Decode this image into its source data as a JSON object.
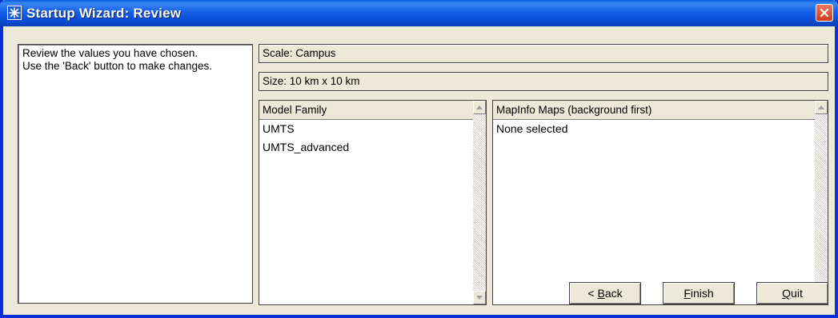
{
  "window": {
    "title": "Startup Wizard: Review"
  },
  "instructions": {
    "line1": "Review the values you have chosen.",
    "line2": "Use the 'Back' button to make changes."
  },
  "summary": {
    "scale": "Scale: Campus",
    "size": "Size: 10 km x 10 km"
  },
  "model_family": {
    "header": "Model Family",
    "items": [
      "UMTS",
      "UMTS_advanced"
    ]
  },
  "mapinfo": {
    "header": "MapInfo Maps (background first)",
    "items": [
      "None selected"
    ]
  },
  "buttons": {
    "back": {
      "prefix": "< ",
      "mnemonic": "B",
      "rest": "ack"
    },
    "finish": {
      "mnemonic": "F",
      "rest": "inish"
    },
    "quit": {
      "mnemonic": "Q",
      "rest": "uit"
    }
  },
  "icons": {
    "app": "star-icon",
    "close": "close-icon",
    "scroll_up": "arrow-up-icon",
    "scroll_down": "arrow-down-icon"
  },
  "colors": {
    "titlebar": "#0a4fd6",
    "window_bg": "#ece9d8",
    "close": "#cf3c18"
  }
}
